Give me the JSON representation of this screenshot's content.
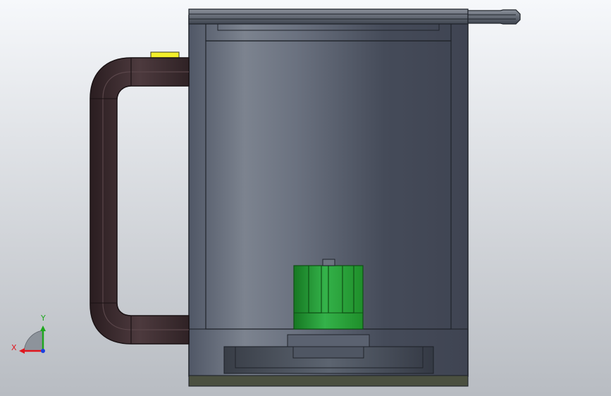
{
  "viewport": {
    "background_top": "#f6f8fb",
    "background_bottom": "#b8bcc2"
  },
  "model": {
    "body_colors": [
      "#505766",
      "#7c838f",
      "#6b7280",
      "#454b59",
      "#3f4452"
    ],
    "outline_color": "#20242b",
    "handle_color": "#3a2a2e",
    "handle_highlight": "#5a464a",
    "base_band_color": "#4b5040",
    "indicator_color": "#f3ef2b",
    "inner_part_color": "#1f8f2a",
    "inner_part_highlight": "#34b24a"
  },
  "triad": {
    "x_label": "X",
    "y_label": "Y",
    "x_color": "#e0161e",
    "y_color": "#1ea71e",
    "z_color": "#1c3fe0",
    "plane_color": "#8d939b"
  }
}
